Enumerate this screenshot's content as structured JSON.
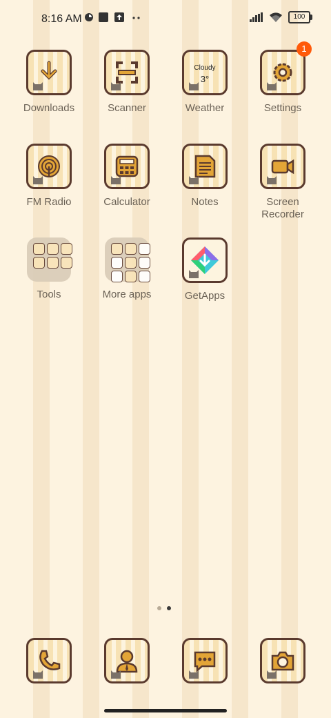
{
  "status_bar": {
    "time": "8:16 AM",
    "battery": "100",
    "icons": [
      "sync-icon",
      "square-icon",
      "upload-icon",
      "more-icon",
      "signal-icon",
      "wifi-icon",
      "battery-icon"
    ]
  },
  "apps": [
    {
      "label": "Downloads",
      "icon": "download-icon"
    },
    {
      "label": "Scanner",
      "icon": "scanner-icon"
    },
    {
      "label": "Weather",
      "icon": "weather-icon",
      "weather_text": "Cloudy",
      "weather_temp": "3°"
    },
    {
      "label": "Settings",
      "icon": "gear-icon",
      "badge": "1"
    },
    {
      "label": "FM Radio",
      "icon": "radio-icon"
    },
    {
      "label": "Calculator",
      "icon": "calculator-icon"
    },
    {
      "label": "Notes",
      "icon": "notes-icon"
    },
    {
      "label": "Screen Recorder",
      "icon": "video-camera-icon"
    },
    {
      "label": "Tools",
      "icon": "folder-icon"
    },
    {
      "label": "More apps",
      "icon": "folder-icon"
    },
    {
      "label": "GetApps",
      "icon": "getapps-icon"
    }
  ],
  "page_indicator": {
    "count": 2,
    "active": 2
  },
  "dock": [
    {
      "icon": "phone-icon"
    },
    {
      "icon": "contacts-icon"
    },
    {
      "icon": "messages-icon"
    },
    {
      "icon": "camera-icon"
    }
  ],
  "colors": {
    "accent": "#e3a537",
    "outline": "#5a3a2e",
    "badge": "#ff5a0a"
  }
}
